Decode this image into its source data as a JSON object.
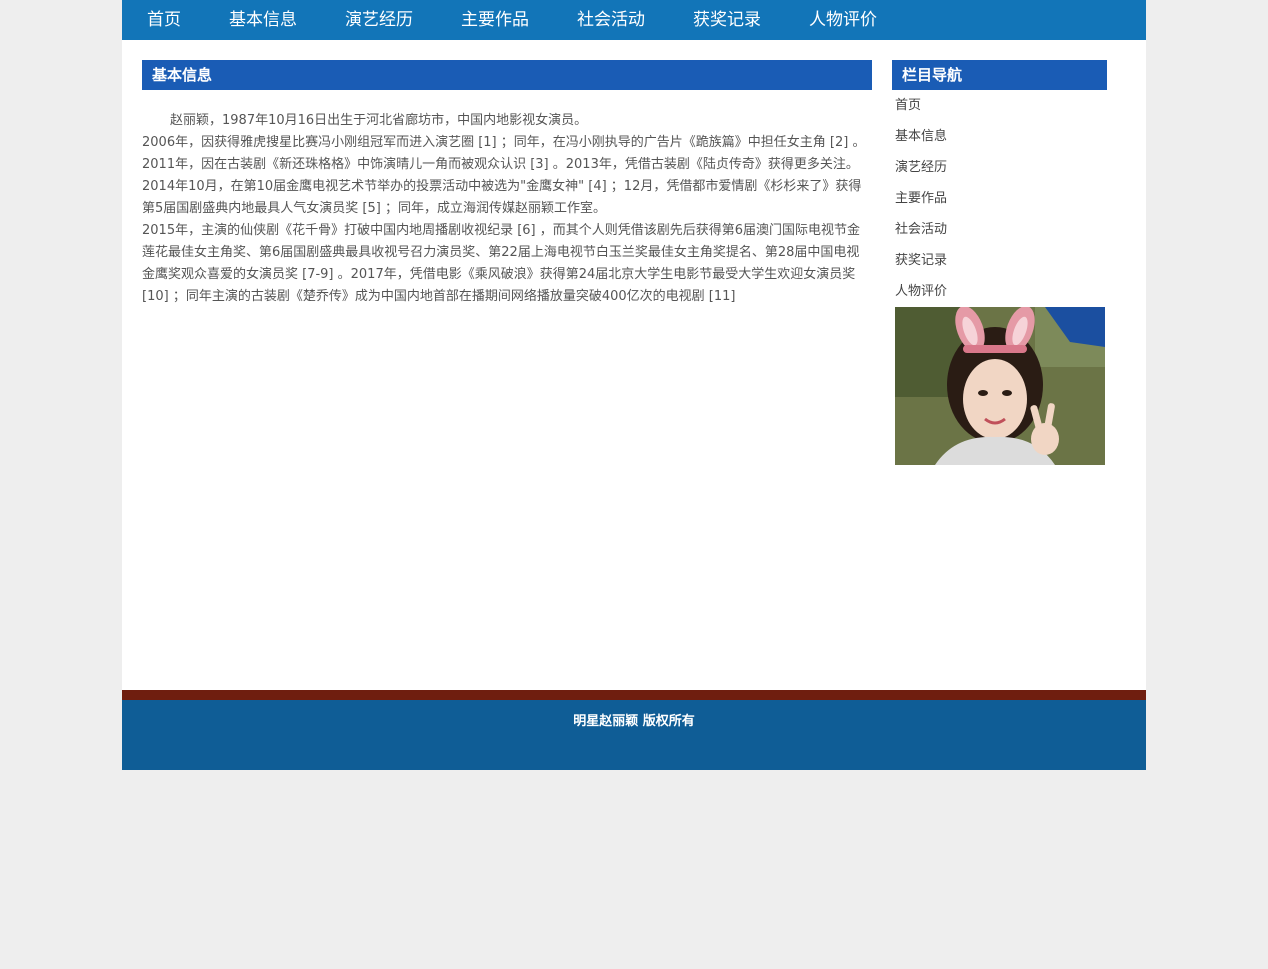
{
  "topnav": {
    "items": [
      "首页",
      "基本信息",
      "演艺经历",
      "主要作品",
      "社会活动",
      "获奖记录",
      "人物评价"
    ]
  },
  "main": {
    "title": "基本信息",
    "paragraphs": [
      "赵丽颖，1987年10月16日出生于河北省廊坊市，中国内地影视女演员。",
      "2006年，因获得雅虎搜星比赛冯小刚组冠军而进入演艺圈 [1] ；同年，在冯小刚执导的广告片《跪族篇》中担任女主角 [2] 。2011年，因在古装剧《新还珠格格》中饰演晴儿一角而被观众认识 [3] 。2013年，凭借古装剧《陆贞传奇》获得更多关注。2014年10月，在第10届金鹰电视艺术节举办的投票活动中被选为\"金鹰女神\" [4] ；12月，凭借都市爱情剧《杉杉来了》获得第5届国剧盛典内地最具人气女演员奖 [5] ；同年，成立海润传媒赵丽颖工作室。",
      "2015年，主演的仙侠剧《花千骨》打破中国内地周播剧收视纪录 [6] ，而其个人则凭借该剧先后获得第6届澳门国际电视节金莲花最佳女主角奖、第6届国剧盛典最具收视号召力演员奖、第22届上海电视节白玉兰奖最佳女主角奖提名、第28届中国电视金鹰奖观众喜爱的女演员奖 [7-9] 。2017年，凭借电影《乘风破浪》获得第24届北京大学生电影节最受大学生欢迎女演员奖 [10] ；同年主演的古装剧《楚乔传》成为中国内地首部在播期间网络播放量突破400亿次的电视剧 [11]"
    ]
  },
  "sidebar": {
    "title": "栏目导航",
    "items": [
      "首页",
      "基本信息",
      "演艺经历",
      "主要作品",
      "社会活动",
      "获奖记录",
      "人物评价"
    ]
  },
  "footer": {
    "text": "明星赵丽颖 版权所有"
  },
  "colors": {
    "nav_bg": "#1275b8",
    "title_bg": "#1a5cb5",
    "footer_bar": "#6f1e0f",
    "footer_bg": "#0f5d96",
    "page_bg": "#eeeeee"
  }
}
